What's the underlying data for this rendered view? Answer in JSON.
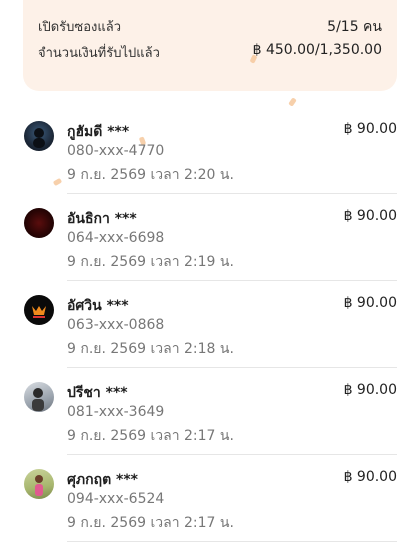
{
  "summary": {
    "opened_label": "เปิดรับซองแล้ว",
    "opened_value": "5/15 คน",
    "amount_label": "จำนวนเงินที่รับไปแล้ว",
    "amount_value": "฿ 450.00/1,350.00"
  },
  "recipients": [
    {
      "name": "กูฮัมดี ***",
      "phone": "080-xxx-4770",
      "time": "9 ก.ย. 2569 เวลา 2:20 น.",
      "amount": "฿ 90.00",
      "avatar": "photo-avatar-dark-blue"
    },
    {
      "name": "อันธิกา ***",
      "phone": "064-xxx-6698",
      "time": "9 ก.ย. 2569 เวลา 2:19 น.",
      "amount": "฿ 90.00",
      "avatar": "photo-avatar-dark-red"
    },
    {
      "name": "อัศวิน ***",
      "phone": "063-xxx-0868",
      "time": "9 ก.ย. 2569 เวลา 2:18 น.",
      "amount": "฿ 90.00",
      "avatar": "logo-avatar-black-orange"
    },
    {
      "name": "ปรีชา ***",
      "phone": "081-xxx-3649",
      "time": "9 ก.ย. 2569 เวลา 2:17 น.",
      "amount": "฿ 90.00",
      "avatar": "photo-avatar-person"
    },
    {
      "name": "ศุภกฤต ***",
      "phone": "094-xxx-6524",
      "time": "9 ก.ย. 2569 เวลา 2:17 น.",
      "amount": "฿ 90.00",
      "avatar": "photo-avatar-child"
    }
  ]
}
